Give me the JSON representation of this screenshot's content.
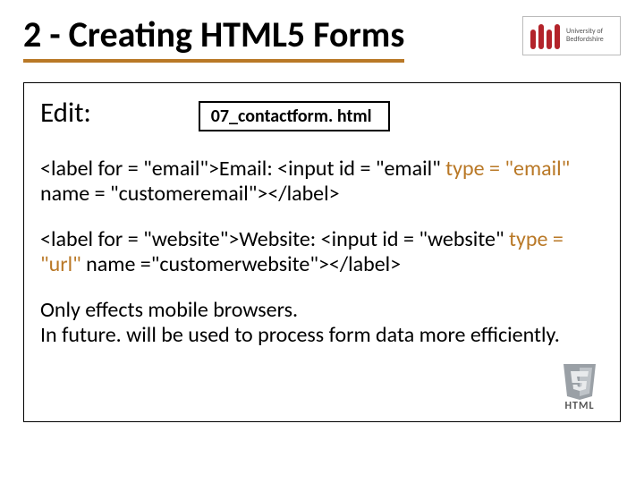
{
  "title": "2 - Creating HTML5 Forms",
  "logo": {
    "line1": "University of",
    "line2": "Bedfordshire"
  },
  "edit_label": "Edit:",
  "filename": "07_contactform. html",
  "code1": {
    "pre": "<label for = \"email\">Email: <input id = \"email\" ",
    "em": "type = \"email\"",
    "post": "  name = \"customeremail\"></label>"
  },
  "code2": {
    "pre": "<label for = \"website\">Website: <input id = \"website\" ",
    "em": "type = \"url\"",
    "post": " name =\"customerwebsite\"></label>"
  },
  "note_line1": "Only effects mobile browsers.",
  "note_line2": "In future. will be used to process form data more efficiently.",
  "html5_label": "HTML"
}
